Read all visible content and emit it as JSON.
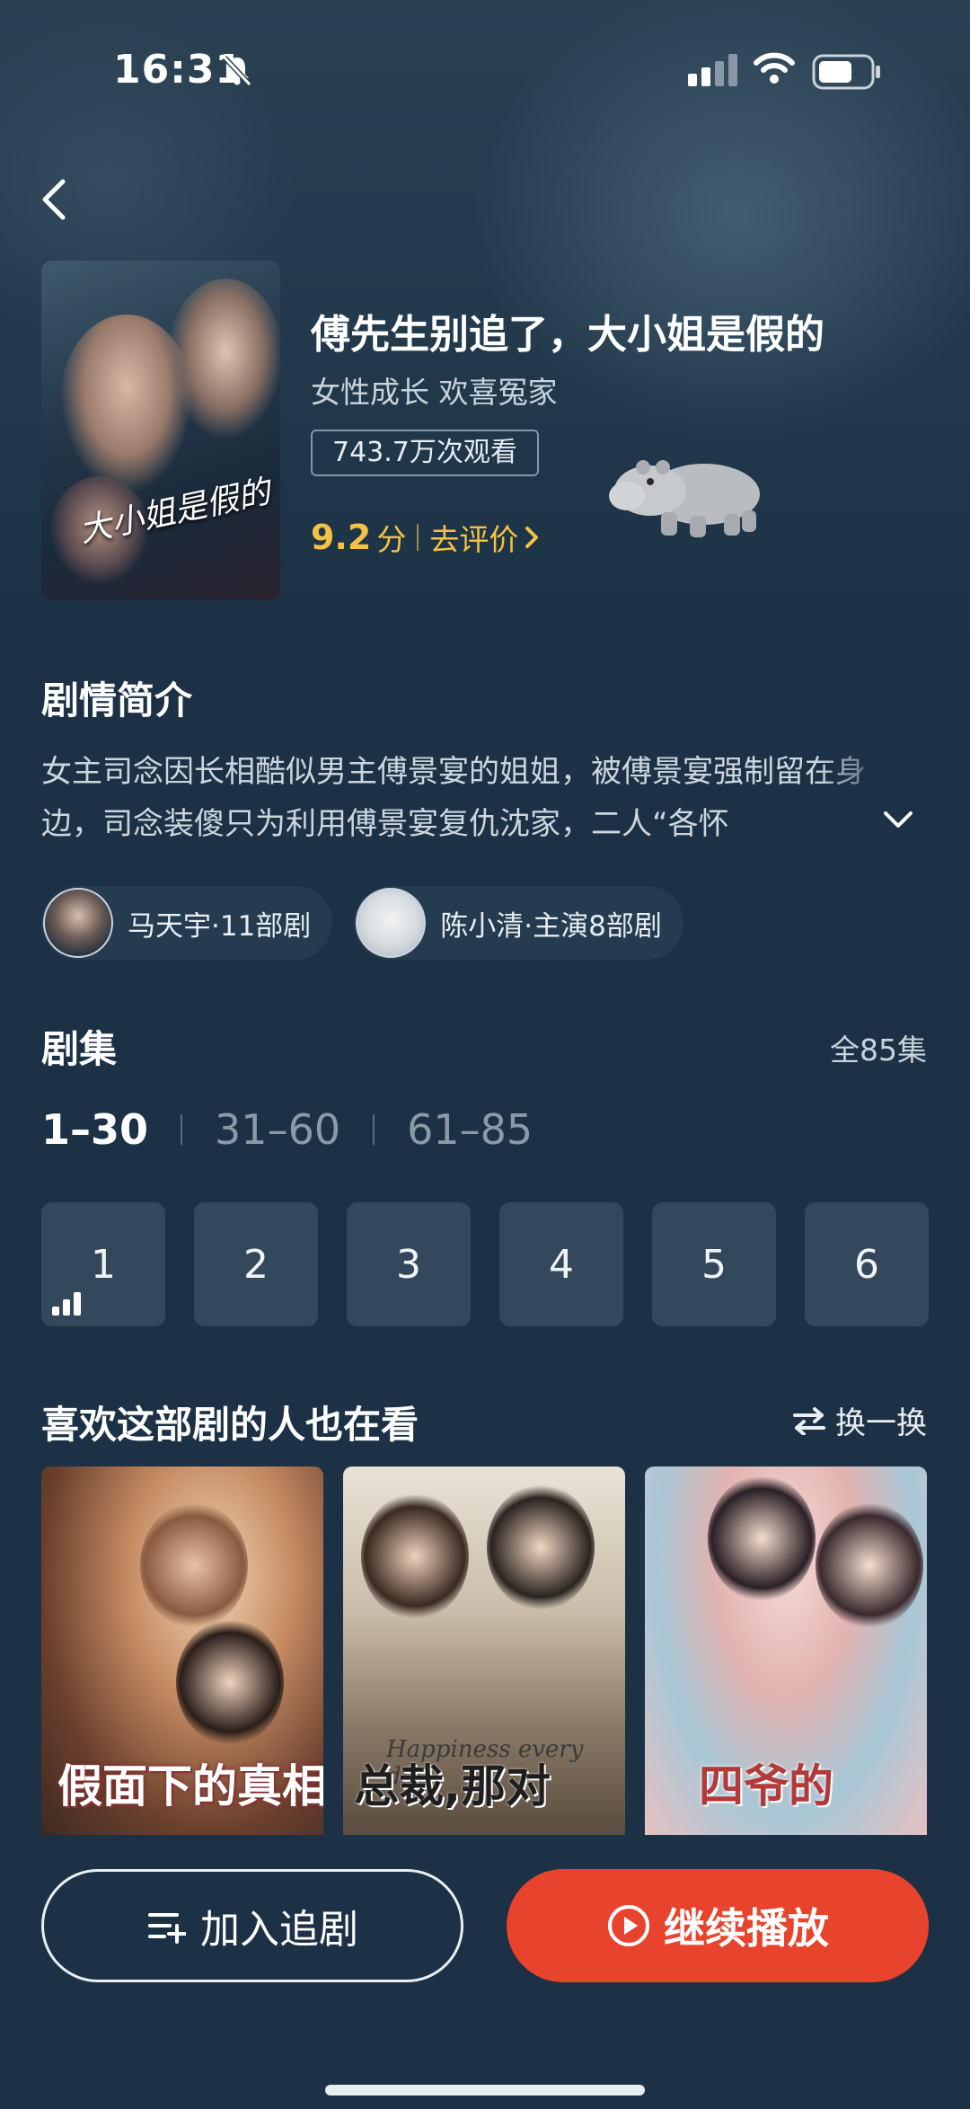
{
  "status_bar": {
    "time": "16:31"
  },
  "drama": {
    "title": "傅先生别追了，大小姐是假的",
    "tags": "女性成长 欢喜冤家",
    "views": "743.7万次观看",
    "rating_score": "9.2",
    "rating_unit": "分",
    "rate_link": "去评价",
    "poster_text": "大小姐是假的"
  },
  "synopsis": {
    "title": "剧情简介",
    "text": "女主司念因长相酷似男主傅景宴的姐姐，被傅景宴强制留在身边，司念装傻只为利用傅景宴复仇沈家，二人“各怀"
  },
  "cast": [
    {
      "label": "马天宇·11部剧"
    },
    {
      "label": "陈小清·主演8部剧"
    }
  ],
  "episodes": {
    "title": "剧集",
    "total": "全85集",
    "ranges": [
      "1–30",
      "31–60",
      "61–85"
    ],
    "active_range": 0,
    "items": [
      "1",
      "2",
      "3",
      "4",
      "5",
      "6"
    ]
  },
  "recommend": {
    "title": "喜欢这部剧的人也在看",
    "refresh_label": "换一换",
    "cards": [
      {
        "caption": "假面下的真相"
      },
      {
        "caption": "总裁,那对",
        "sub": "Happiness every day"
      },
      {
        "caption": "四爷的"
      }
    ]
  },
  "actions": {
    "follow_label": "加入追剧",
    "play_label": "继续播放"
  },
  "colors": {
    "background": "#1c3145",
    "accent_red": "#e8442d",
    "rating_gold": "#f3c245"
  }
}
